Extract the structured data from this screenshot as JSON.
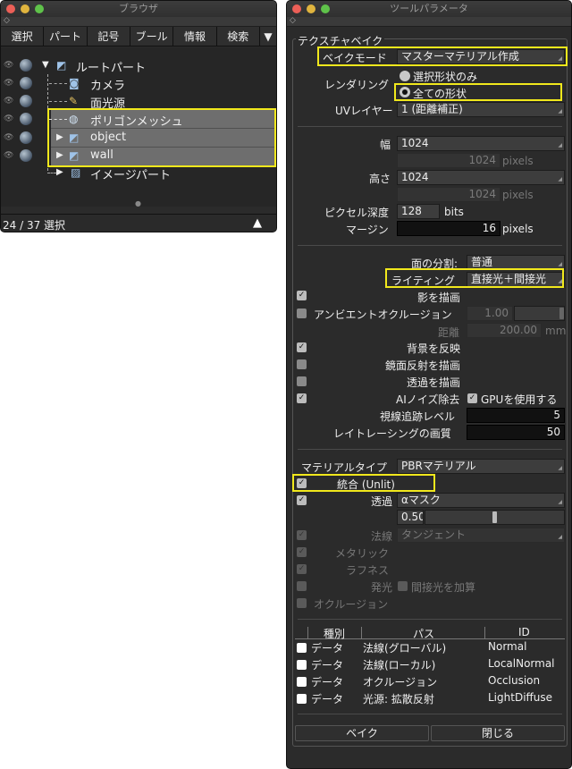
{
  "browser": {
    "title": "ブラウザ",
    "menu": [
      "選択",
      "パート",
      "記号",
      "ブール",
      "情報",
      "検索"
    ],
    "menu_arrow": "▼",
    "tree": [
      {
        "label": "ルートパート",
        "indent": 0,
        "expand": "▼",
        "icon": "root-part-icon"
      },
      {
        "label": "カメラ",
        "indent": 1,
        "expand": "",
        "icon": "camera-icon"
      },
      {
        "label": "面光源",
        "indent": 1,
        "expand": "",
        "icon": "area-light-icon"
      },
      {
        "label": "ポリゴンメッシュ",
        "indent": 1,
        "expand": "",
        "icon": "polygon-mesh-icon"
      },
      {
        "label": "object",
        "indent": 1,
        "expand": "▶",
        "icon": "part-icon"
      },
      {
        "label": "wall",
        "indent": 1,
        "expand": "▶",
        "icon": "part-icon"
      },
      {
        "label": "イメージパート",
        "indent": 1,
        "expand": "▶",
        "icon": "image-part-icon"
      }
    ],
    "status": "24 / 37 選択",
    "up_arrow": "▲"
  },
  "tool": {
    "title": "ツールパラメータ",
    "section": "テクスチャベイク",
    "bake_mode_label": "ベイクモード",
    "bake_mode_value": "マスターマテリアル作成",
    "rendering_label": "レンダリング",
    "rendering_opt1": "選択形状のみ",
    "rendering_opt2": "全ての形状",
    "uv_label": "UVレイヤー",
    "uv_value": "1 (距離補正)",
    "width_label": "幅",
    "width_value": "1024",
    "width_px": "1024",
    "pixels": "pixels",
    "height_label": "高さ",
    "height_value": "1024",
    "height_px": "1024",
    "depth_label": "ピクセル深度",
    "depth_value": "128",
    "bits": "bits",
    "margin_label": "マージン",
    "margin_value": "16",
    "face_div_label": "面の分割:",
    "face_div_value": "普通",
    "lighting_label": "ライティング",
    "lighting_value": "直接光＋間接光",
    "shadow_label": "影を描画",
    "ao_label": "アンビエントオクルージョン",
    "ao_value": "1.00",
    "distance_label": "距離",
    "distance_value": "200.00",
    "mm": "mm",
    "bg_label": "背景を反映",
    "mirror_label": "鏡面反射を描画",
    "transp_label": "透過を描画",
    "ai_label": "AIノイズ除去",
    "gpu_label": "GPUを使用する",
    "raytrace_label": "視線追跡レベル",
    "raytrace_value": "5",
    "quality_label": "レイトレーシングの画質",
    "quality_value": "50",
    "mat_type_label": "マテリアルタイプ",
    "mat_type_value": "PBRマテリアル",
    "unlit_label": "統合 (Unlit)",
    "transp2_label": "透過",
    "transp2_value": "αマスク",
    "alpha_value": "0.50",
    "normal_label": "法線",
    "normal_value": "タンジェント",
    "metallic_label": "メタリック",
    "roughness_label": "ラフネス",
    "emit_label": "発光",
    "indirect_add_label": "間接光を加算",
    "occlusion_label": "オクルージョン",
    "table_headers": [
      "種別",
      "パス",
      "ID"
    ],
    "table_rows": [
      {
        "kind": "データ",
        "path": "法線(グローバル)",
        "id": "Normal"
      },
      {
        "kind": "データ",
        "path": "法線(ローカル)",
        "id": "LocalNormal"
      },
      {
        "kind": "データ",
        "path": "オクルージョン",
        "id": "Occlusion"
      },
      {
        "kind": "データ",
        "path": "光源: 拡散反射",
        "id": "LightDiffuse"
      }
    ],
    "bake_button": "ベイク",
    "close_button": "閉じる",
    "check_mark": "✓"
  },
  "colors": {
    "highlight": "#f1e81c",
    "panel": "#2b2b2b"
  }
}
